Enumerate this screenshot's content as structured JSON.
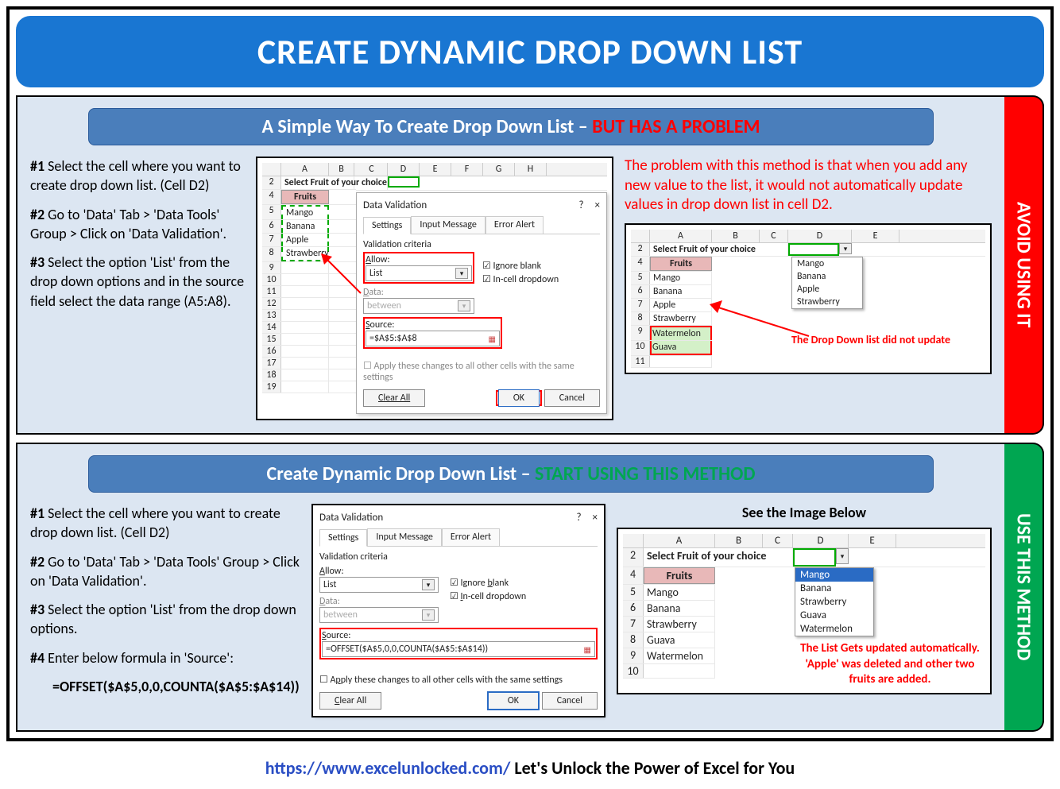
{
  "title": "CREATE DYNAMIC DROP DOWN LIST",
  "section1": {
    "header_main": "A Simple Way To Create Drop Down List – ",
    "header_warn": "BUT HAS A PROBLEM",
    "side_tab": "AVOID USING IT",
    "step1_label": "#1",
    "step1_text": " Select the cell where you want to create drop down list. (Cell D2)",
    "step2_label": "#2",
    "step2_text": " Go to 'Data' Tab > 'Data Tools' Group > Click on 'Data Validation'.",
    "step3_label": "#3",
    "step3_text": " Select the option 'List' from the drop down options and in the source field select the data range (A5:A8).",
    "cols": [
      "A",
      "B",
      "C",
      "D",
      "E",
      "F",
      "G",
      "H"
    ],
    "row2_label": "Select Fruit of your choice",
    "fruits_header": "Fruits",
    "fruits": [
      "Mango",
      "Banana",
      "Apple",
      "Strawberry"
    ],
    "dialog_title": "Data Validation",
    "tabs": [
      "Settings",
      "Input Message",
      "Error Alert"
    ],
    "criteria_label": "Validation criteria",
    "allow_label": "Allow:",
    "allow_value": "List",
    "data_label": "Data:",
    "data_value": "between",
    "source_label": "Source:",
    "source_value": "=$A$5:$A$8",
    "ignore_blank": "Ignore blank",
    "incell_dd": "In-cell dropdown",
    "apply_all": "Apply these changes to all other cells with the same settings",
    "clear_all": "Clear All",
    "ok": "OK",
    "cancel": "Cancel",
    "problem_text": "The problem with this method is that when you add any new value to the list, it would not automatically update values in drop down list in cell D2.",
    "result_cols": [
      "A",
      "B",
      "C",
      "D",
      "E"
    ],
    "result_fruits": [
      "Mango",
      "Banana",
      "Apple",
      "Strawberry",
      "Watermelon",
      "Guava"
    ],
    "dd_items": [
      "Mango",
      "Banana",
      "Apple",
      "Strawberry"
    ],
    "result_note": "The Drop Down list did not update"
  },
  "section2": {
    "header_main": "Create Dynamic Drop Down List – ",
    "header_go": "START USING THIS METHOD",
    "side_tab": "USE THIS METHOD",
    "step1_label": "#1",
    "step1_text": " Select the cell where you want to create drop down list. (Cell D2)",
    "step2_label": "#2",
    "step2_text": " Go to 'Data' Tab > 'Data Tools' Group > Click on 'Data Validation'.",
    "step3_label": "#3",
    "step3_text": " Select the option 'List' from the drop down options.",
    "step4_label": "#4",
    "step4_text": " Enter below formula in 'Source':",
    "formula": "=OFFSET($A$5,0,0,COUNTA($A$5:$A$14))",
    "dialog_title": "Data Validation",
    "source_value": "=OFFSET($A$5,0,0,COUNTA($A$5:$A$14))",
    "see_below": "See the Image Below",
    "result_cols": [
      "A",
      "B",
      "C",
      "D",
      "E"
    ],
    "row2_label": "Select Fruit of your choice",
    "fruits_header": "Fruits",
    "fruits": [
      "Mango",
      "Banana",
      "Strawberry",
      "Guava",
      "Watermelon"
    ],
    "dd_items": [
      "Mango",
      "Banana",
      "Strawberry",
      "Guava",
      "Watermelon"
    ],
    "result_note": "The List Gets updated automatically. 'Apple' was deleted and other two fruits are added."
  },
  "footer_link": "https://www.excelunlocked.com/",
  "footer_text": " Let's Unlock the Power of Excel for You"
}
